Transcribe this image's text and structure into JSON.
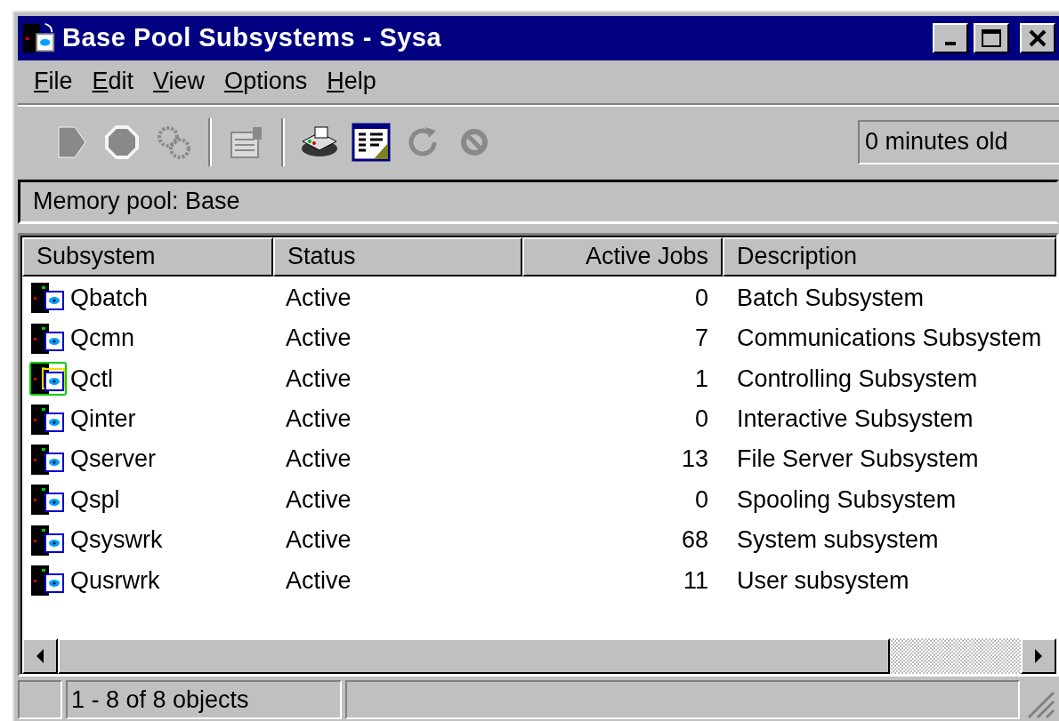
{
  "window": {
    "title": "Base Pool Subsystems - Sysa"
  },
  "menu": [
    {
      "label": "File"
    },
    {
      "label": "Edit"
    },
    {
      "label": "View"
    },
    {
      "label": "Options"
    },
    {
      "label": "Help"
    }
  ],
  "toolbar": [
    {
      "kind": "start",
      "disabled": true
    },
    {
      "kind": "stop",
      "disabled": true
    },
    {
      "kind": "gears",
      "disabled": true
    },
    {
      "kind": "separator"
    },
    {
      "kind": "properties",
      "disabled": true
    },
    {
      "kind": "separator"
    },
    {
      "kind": "printer",
      "disabled": false
    },
    {
      "kind": "columns",
      "disabled": false
    },
    {
      "kind": "refresh",
      "disabled": true
    },
    {
      "kind": "cancel",
      "disabled": true
    }
  ],
  "age": "0 minutes old",
  "pool_label": "Memory pool:  Base",
  "table": {
    "columns": [
      {
        "label": "Subsystem"
      },
      {
        "label": "Status"
      },
      {
        "label": "Active Jobs"
      },
      {
        "label": "Description"
      }
    ],
    "rows": [
      {
        "kind": "subsystem",
        "name": "Qbatch",
        "status": "Active",
        "jobs": "0",
        "description": "Batch Subsystem"
      },
      {
        "kind": "subsystem",
        "name": "Qcmn",
        "status": "Active",
        "jobs": "7",
        "description": "Communications Subsystem"
      },
      {
        "kind": "controlling",
        "name": "Qctl",
        "status": "Active",
        "jobs": "1",
        "description": "Controlling Subsystem"
      },
      {
        "kind": "subsystem",
        "name": "Qinter",
        "status": "Active",
        "jobs": "0",
        "description": "Interactive Subsystem"
      },
      {
        "kind": "subsystem",
        "name": "Qserver",
        "status": "Active",
        "jobs": "13",
        "description": "File Server Subsystem"
      },
      {
        "kind": "subsystem",
        "name": "Qspl",
        "status": "Active",
        "jobs": "0",
        "description": "Spooling Subsystem"
      },
      {
        "kind": "subsystem",
        "name": "Qsyswrk",
        "status": "Active",
        "jobs": "68",
        "description": "System subsystem"
      },
      {
        "kind": "subsystem",
        "name": "Qusrwrk",
        "status": "Active",
        "jobs": "11",
        "description": "User subsystem"
      }
    ]
  },
  "status_bar": {
    "count": "1 - 8 of 8 objects"
  }
}
